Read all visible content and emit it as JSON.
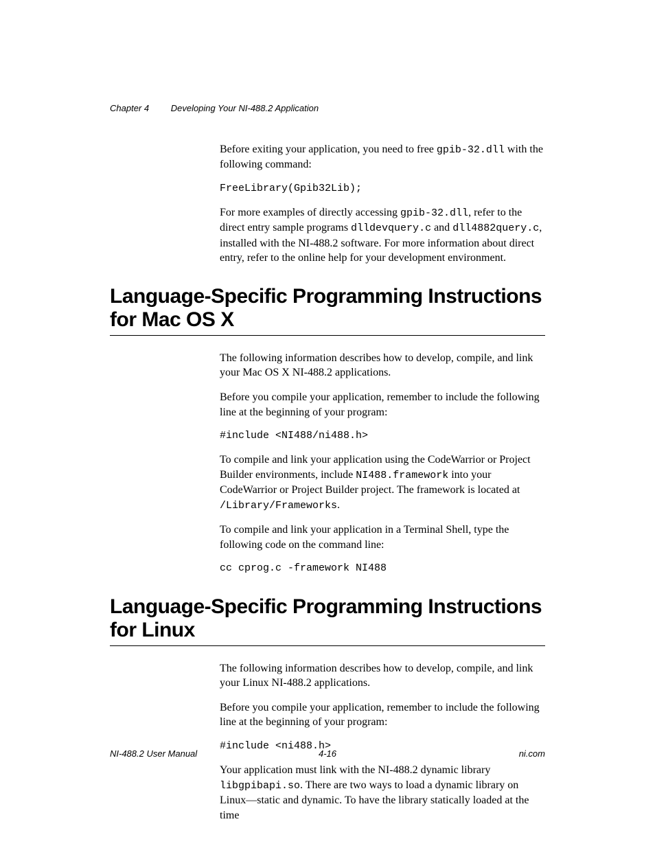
{
  "header": {
    "chapter_label": "Chapter 4",
    "chapter_title": "Developing Your NI-488.2 Application"
  },
  "intro": {
    "p1_a": "Before exiting your application, you need to free ",
    "p1_code": "gpib-32.dll",
    "p1_b": " with the following command:",
    "code1": "FreeLibrary(Gpib32Lib);",
    "p2_a": "For more examples of directly accessing ",
    "p2_code1": "gpib-32.dll",
    "p2_b": ", refer to the direct entry sample programs ",
    "p2_code2": "dlldevquery.c",
    "p2_c": " and ",
    "p2_code3": "dll4882query.c",
    "p2_d": ", installed with the NI-488.2 software. For more information about direct entry, refer to the online help for your development environment."
  },
  "mac": {
    "heading": "Language-Specific Programming Instructions for Mac OS X",
    "p1": "The following information describes how to develop, compile, and link your Mac OS X NI-488.2 applications.",
    "p2": "Before you compile your application, remember to include the following line at the beginning of your program:",
    "code1": "#include <NI488/ni488.h>",
    "p3_a": "To compile and link your application using the CodeWarrior or Project Builder environments, include ",
    "p3_code1": "NI488.framework",
    "p3_b": " into your CodeWarrior or Project Builder project. The framework is located at ",
    "p3_code2": "/Library/Frameworks",
    "p3_c": ".",
    "p4": "To compile and link your application in a Terminal Shell, type the following code on the command line:",
    "code2": "cc cprog.c -framework NI488"
  },
  "linux": {
    "heading": "Language-Specific Programming Instructions for Linux",
    "p1": "The following information describes how to develop, compile, and link your Linux NI-488.2 applications.",
    "p2": "Before you compile your application, remember to include the following line at the beginning of your program:",
    "code1": "#include <ni488.h>",
    "p3_a": "Your application must link with the NI-488.2 dynamic library ",
    "p3_code1": "libgpibapi.so",
    "p3_b": ". There are two ways to load a dynamic library on Linux—static and dynamic. To have the library statically loaded at the time"
  },
  "footer": {
    "left": "NI-488.2 User Manual",
    "center": "4-16",
    "right": "ni.com"
  }
}
